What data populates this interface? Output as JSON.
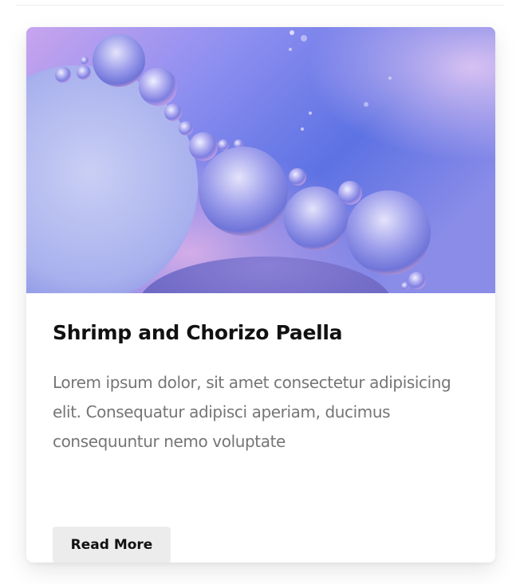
{
  "card": {
    "title": "Shrimp and Chorizo Paella",
    "description": "Lorem ipsum dolor, sit amet consectetur adipisicing elit. Consequatur adipisci aperiam, ducimus consequuntur nemo voluptate",
    "button_label": "Read More"
  },
  "colors": {
    "image_base": "#6d7fe8",
    "image_accent": "#c79bea",
    "title": "#111111",
    "text": "#757575",
    "button_bg": "#ececec"
  }
}
